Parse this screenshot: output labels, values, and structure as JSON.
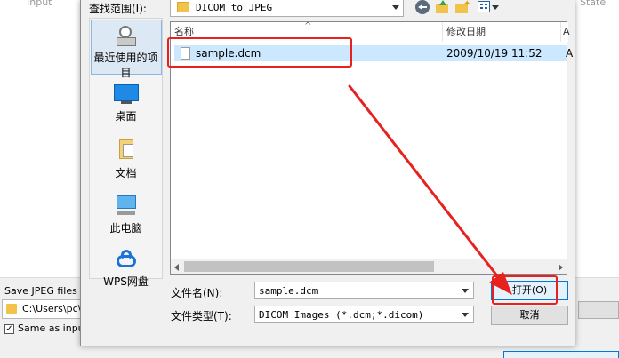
{
  "background_app": {
    "header_left": "Input",
    "header_right": "State",
    "save_label": "Save JPEG files to",
    "save_path": "C:\\Users\\pc\\",
    "same_as_input": "Same as input"
  },
  "dialog": {
    "look_in_label": "查找范围(I):",
    "look_in_value": "DICOM to JPEG",
    "places": [
      {
        "label": "最近使用的项目",
        "icon": "recent-items-icon"
      },
      {
        "label": "桌面",
        "icon": "desktop-icon"
      },
      {
        "label": "文档",
        "icon": "documents-icon"
      },
      {
        "label": "此电脑",
        "icon": "this-pc-icon"
      },
      {
        "label": "WPS网盘",
        "icon": "wps-cloud-icon"
      }
    ],
    "columns": {
      "name": "名称",
      "modified": "修改日期",
      "type": "A"
    },
    "files": [
      {
        "name": "sample.dcm",
        "modified": "2009/10/19 11:52",
        "type": "A"
      }
    ],
    "filename_label": "文件名(N):",
    "filename_value": "sample.dcm",
    "filetype_label": "文件类型(T):",
    "filetype_value": "DICOM Images (*.dcm;*.dicom)",
    "open_button": "打开(O)",
    "cancel_button": "取消"
  },
  "colors": {
    "highlight": "#e8211f",
    "selection": "#cce8ff",
    "accent": "#0078d7"
  }
}
